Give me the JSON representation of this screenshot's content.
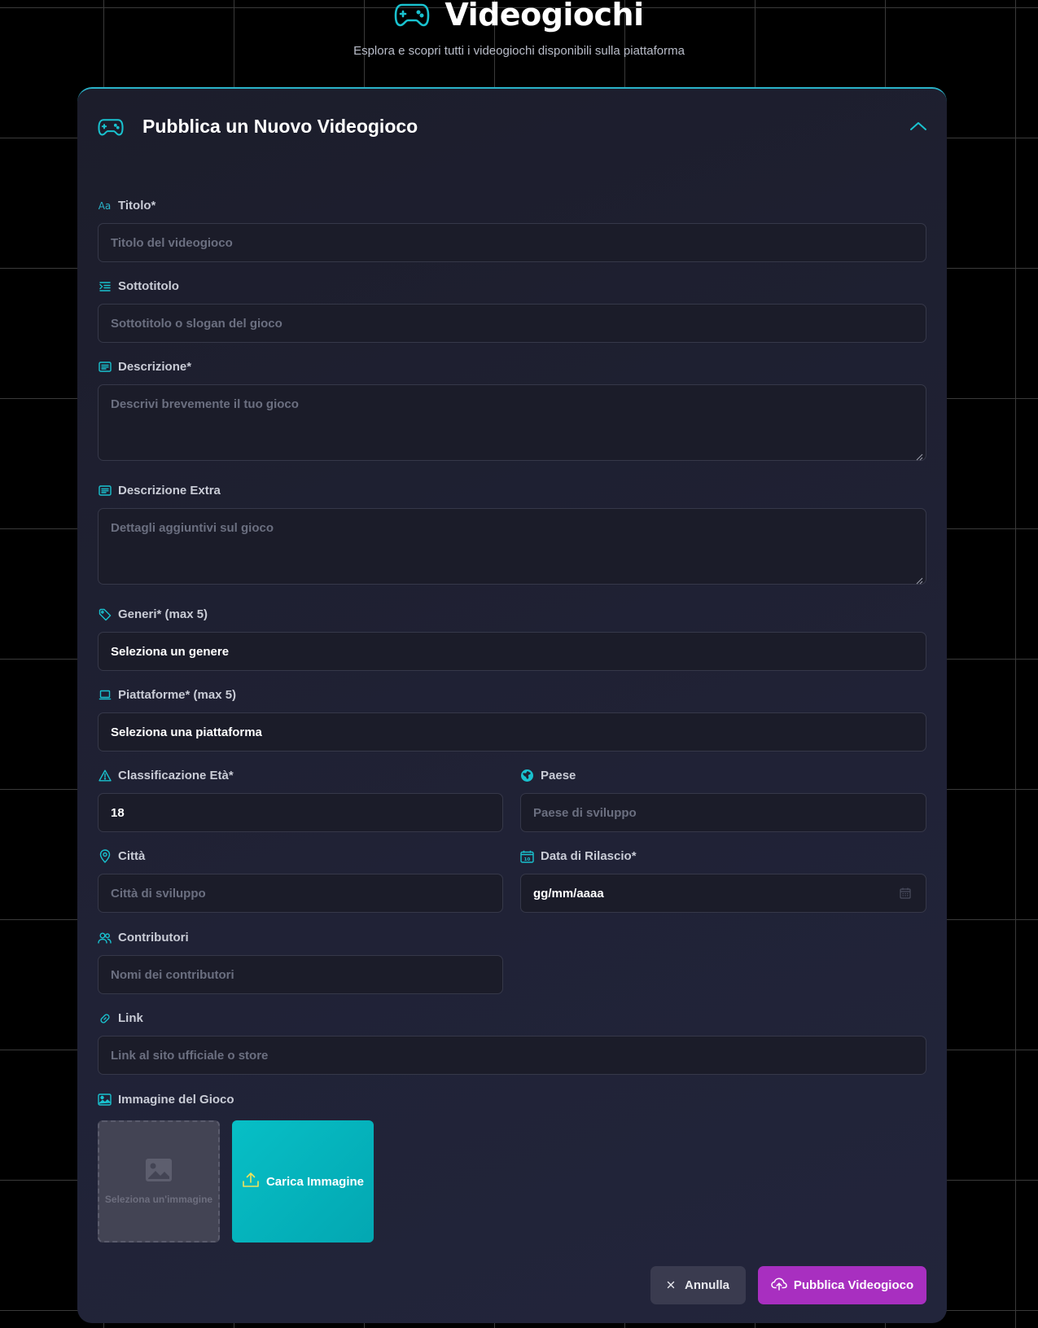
{
  "page": {
    "title": "Videogiochi",
    "subtitle": "Esplora e scopri tutti i videogiochi disponibili sulla piattaforma",
    "title_icon": "gamepad-icon"
  },
  "form": {
    "header_title": "Pubblica un Nuovo Videogioco",
    "header_icon": "gamepad-icon",
    "collapse_icon": "chevron-up-icon",
    "fields": {
      "titolo": {
        "label": "Titolo*",
        "icon_text": "Aa",
        "placeholder": "Titolo del videogioco"
      },
      "sottotitolo": {
        "label": "Sottotitolo",
        "icon": "indent-icon",
        "placeholder": "Sottotitolo o slogan del gioco"
      },
      "descrizione": {
        "label": "Descrizione*",
        "icon": "text-box-icon",
        "placeholder": "Descrivi brevemente il tuo gioco"
      },
      "descrizione_extra": {
        "label": "Descrizione Extra",
        "icon": "text-box-icon",
        "placeholder": "Dettagli aggiuntivi sul gioco"
      },
      "generi": {
        "label": "Generi* (max 5)",
        "icon": "tag-icon",
        "value": "Seleziona un genere"
      },
      "piattaforme": {
        "label": "Piattaforme* (max 5)",
        "icon": "laptop-icon",
        "value": "Seleziona una piattaforma"
      },
      "classificazione": {
        "label": "Classificazione Età*",
        "icon": "warning-icon",
        "value": "18"
      },
      "paese": {
        "label": "Paese",
        "icon": "globe-icon",
        "placeholder": "Paese di sviluppo"
      },
      "citta": {
        "label": "Città",
        "icon": "location-pin-icon",
        "placeholder": "Città di sviluppo"
      },
      "data_rilascio": {
        "label": "Data di Rilascio*",
        "icon": "calendar-icon",
        "value": "gg/mm/aaaa"
      },
      "contributori": {
        "label": "Contributori",
        "icon": "users-icon",
        "placeholder": "Nomi dei contributori"
      },
      "link": {
        "label": "Link",
        "icon": "link-icon",
        "placeholder": "Link al sito ufficiale o store"
      },
      "immagine": {
        "label": "Immagine del Gioco",
        "icon": "image-icon",
        "placeholder_text": "Seleziona un'immagine"
      }
    },
    "upload_button": "Carica Immagine",
    "cancel_button": "Annulla",
    "publish_button": "Pubblica Videogioco"
  },
  "colors": {
    "accent": "#2ab3c9",
    "upload": "#07bfc6",
    "publish": "#a82fc0",
    "card_bg": "#1c1d2b"
  }
}
